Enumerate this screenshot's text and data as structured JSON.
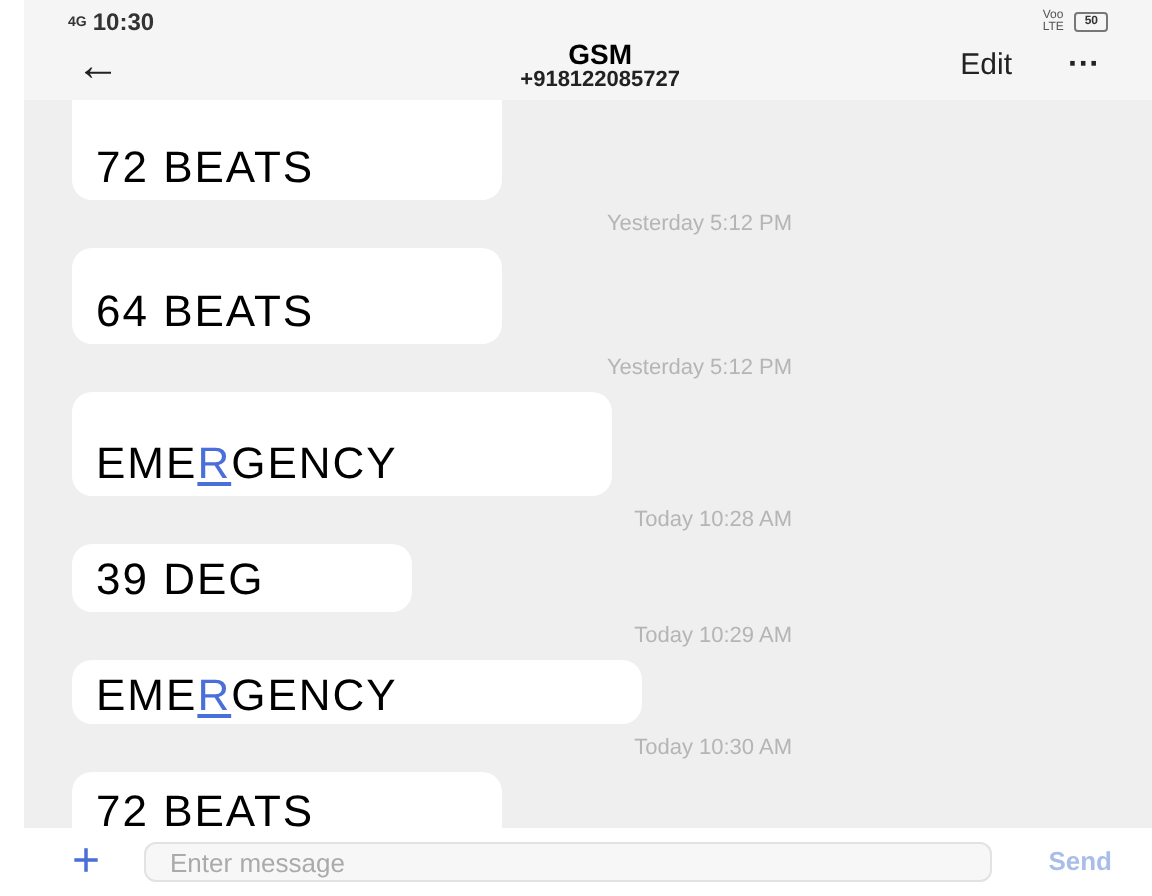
{
  "status_bar": {
    "network": "4G",
    "time": "10:30",
    "volte": "Voo LTE",
    "battery": "50"
  },
  "header": {
    "back": "←",
    "title": "GSM",
    "subtitle": "+918122085727",
    "edit": "Edit",
    "more": "···"
  },
  "messages": [
    {
      "parts": [
        {
          "text": "72 BEATS",
          "highlighted": false
        }
      ],
      "time": "Yesterday 5:12 PM"
    },
    {
      "parts": [
        {
          "text": "64 BEATS",
          "highlighted": false
        }
      ],
      "time": "Yesterday 5:12 PM"
    },
    {
      "parts": [
        {
          "text": "EME",
          "highlighted": false
        },
        {
          "text": "R",
          "highlighted": true
        },
        {
          "text": "GENCY",
          "highlighted": false
        }
      ],
      "time": "Today 10:28 AM"
    },
    {
      "parts": [
        {
          "text": "39 DEG",
          "highlighted": false
        }
      ],
      "time": "Today 10:29 AM"
    },
    {
      "parts": [
        {
          "text": "EME",
          "highlighted": false
        },
        {
          "text": "R",
          "highlighted": true
        },
        {
          "text": "GENCY",
          "highlighted": false
        }
      ],
      "time": "Today 10:30 AM"
    },
    {
      "parts": [
        {
          "text": "72 BEATS",
          "highlighted": false
        }
      ]
    }
  ],
  "composer": {
    "add": "+",
    "placeholder": "Enter message",
    "send": "Send"
  }
}
